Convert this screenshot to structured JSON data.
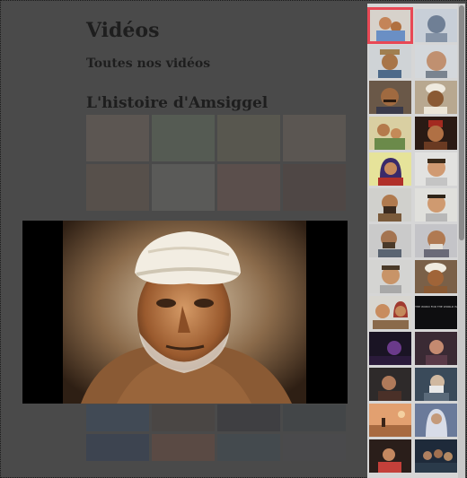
{
  "page": {
    "title": "Vidéos",
    "subtitle": "Toutes nos vidéos",
    "section_heading": "L'histoire d'Amsiggel"
  },
  "lightbox": {
    "image": "portrait-man-white-turban"
  },
  "sidebar": {
    "selected_index": 0,
    "thumbnails": [
      {
        "name": "thumb-mother-child"
      },
      {
        "name": "thumb-man-sketch"
      },
      {
        "name": "thumb-man-hat"
      },
      {
        "name": "thumb-bald-man"
      },
      {
        "name": "thumb-man-mustache"
      },
      {
        "name": "thumb-man-turban-sketch"
      },
      {
        "name": "thumb-woman-child"
      },
      {
        "name": "thumb-man-red-hat"
      },
      {
        "name": "thumb-woman-headscarf"
      },
      {
        "name": "thumb-young-man"
      },
      {
        "name": "thumb-bearded-man"
      },
      {
        "name": "thumb-young-man-2"
      },
      {
        "name": "thumb-man-beard-sketch"
      },
      {
        "name": "thumb-old-man"
      },
      {
        "name": "thumb-man-sketch-2"
      },
      {
        "name": "thumb-man-white-turban"
      },
      {
        "name": "thumb-couple"
      },
      {
        "name": "thumb-credits",
        "caption": "THE WORD FOR THE WORLD IS"
      },
      {
        "name": "thumb-film-night"
      },
      {
        "name": "thumb-film-woman"
      },
      {
        "name": "thumb-film-woman-2"
      },
      {
        "name": "thumb-film-old-man"
      },
      {
        "name": "thumb-film-desert"
      },
      {
        "name": "thumb-film-veiled-woman"
      },
      {
        "name": "thumb-film-bride"
      },
      {
        "name": "thumb-film-crowd"
      }
    ]
  }
}
